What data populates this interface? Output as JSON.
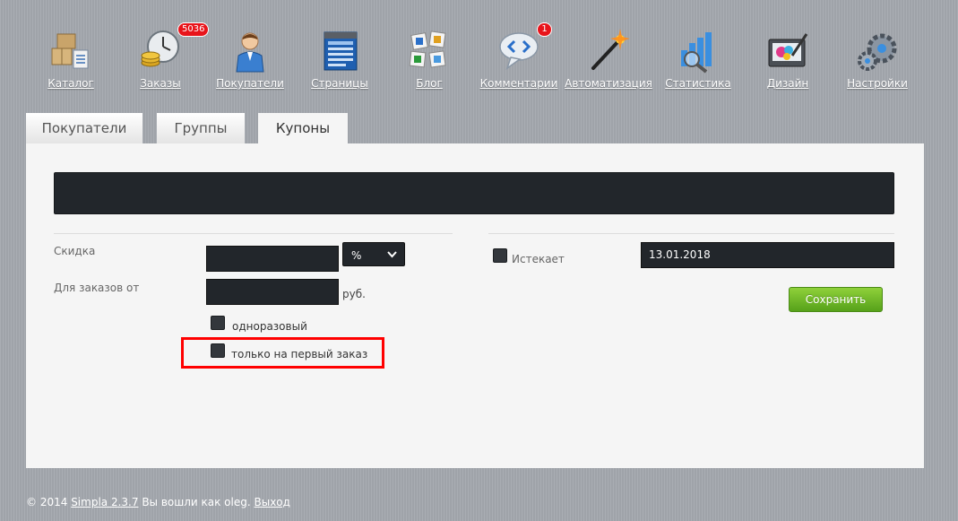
{
  "nav": [
    {
      "label": "Каталог",
      "icon": "catalog-icon"
    },
    {
      "label": "Заказы",
      "icon": "orders-icon",
      "badge": "5036"
    },
    {
      "label": "Покупатели",
      "icon": "customers-icon"
    },
    {
      "label": "Страницы",
      "icon": "pages-icon"
    },
    {
      "label": "Блог",
      "icon": "blog-icon"
    },
    {
      "label": "Комментарии",
      "icon": "comments-icon",
      "badge": "1"
    },
    {
      "label": "Автоматизация",
      "icon": "automation-wand-icon"
    },
    {
      "label": "Статистика",
      "icon": "statistics-icon"
    },
    {
      "label": "Дизайн",
      "icon": "design-icon"
    },
    {
      "label": "Настройки",
      "icon": "settings-gears-icon"
    }
  ],
  "tabs": [
    {
      "label": "Покупатели",
      "active": false
    },
    {
      "label": "Группы",
      "active": false
    },
    {
      "label": "Купоны",
      "active": true
    }
  ],
  "form": {
    "name_value": "",
    "discount_label": "Скидка",
    "discount_value": "",
    "discount_type_selected": "%",
    "min_order_label": "Для заказов от",
    "min_order_value": "",
    "currency": "руб.",
    "single_use_label": "одноразовый",
    "first_order_label": "только на первый заказ",
    "expires_label": "Истекает",
    "expires_value": "13.01.2018",
    "save_label": "Сохранить"
  },
  "footer": {
    "copyright": "© 2014",
    "product": "Simpla 2.3.7",
    "logged_in_text": "Вы вошли как oleg.",
    "logout": "Выход"
  },
  "colors": {
    "badge": "#e8141b",
    "save": "#6bb325",
    "highlight": "#ff0000"
  }
}
